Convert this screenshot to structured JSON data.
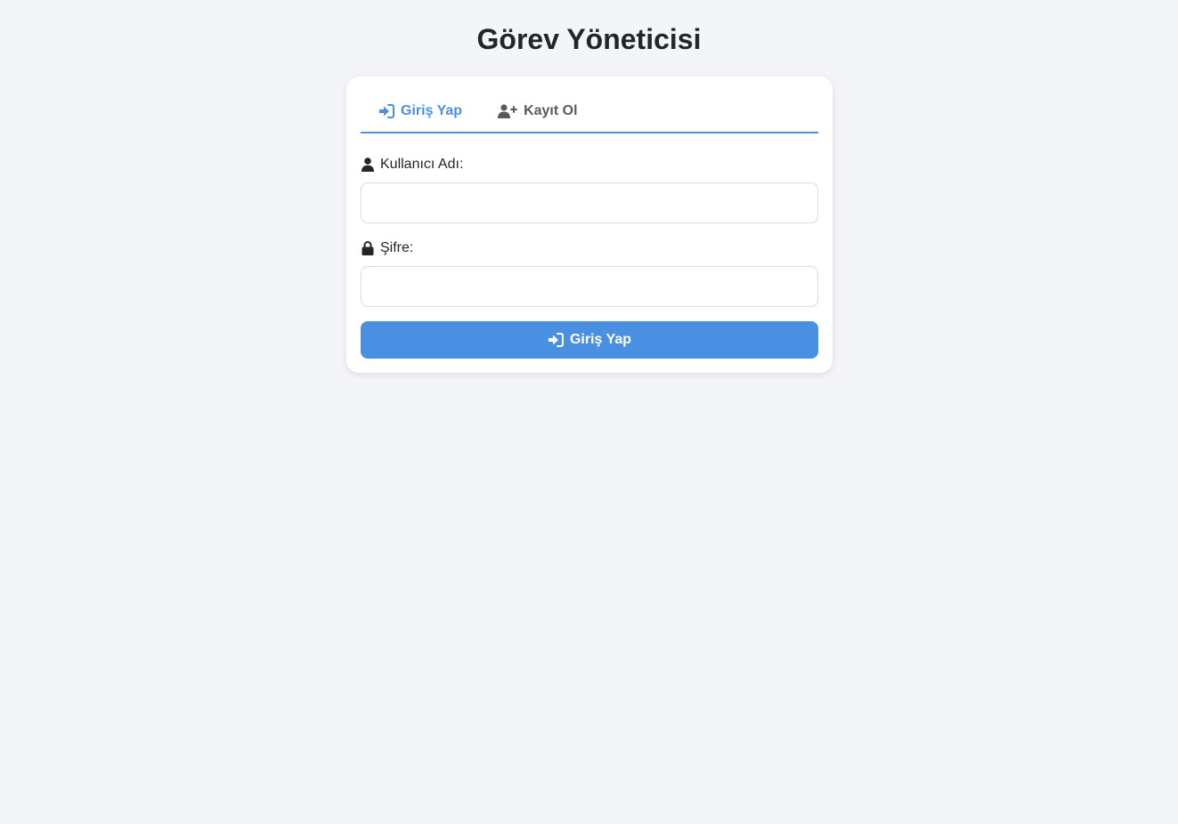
{
  "page_title": "Görev Yöneticisi",
  "tabs": [
    {
      "label": "Giriş Yap",
      "icon": "sign-in-icon",
      "active": true
    },
    {
      "label": "Kayıt Ol",
      "icon": "user-plus-icon",
      "active": false
    }
  ],
  "login_form": {
    "username_label": "Kullanıcı Adı:",
    "username_icon": "user-icon",
    "username_value": "",
    "password_label": "Şifre:",
    "password_icon": "lock-icon",
    "password_value": "",
    "submit_label": "Giriş Yap",
    "submit_icon": "sign-in-icon"
  },
  "colors": {
    "accent": "#4a90e2",
    "background": "#f4f5f9",
    "card": "#ffffff",
    "text": "#23252b",
    "inactive_tab": "#5a5a5a"
  }
}
